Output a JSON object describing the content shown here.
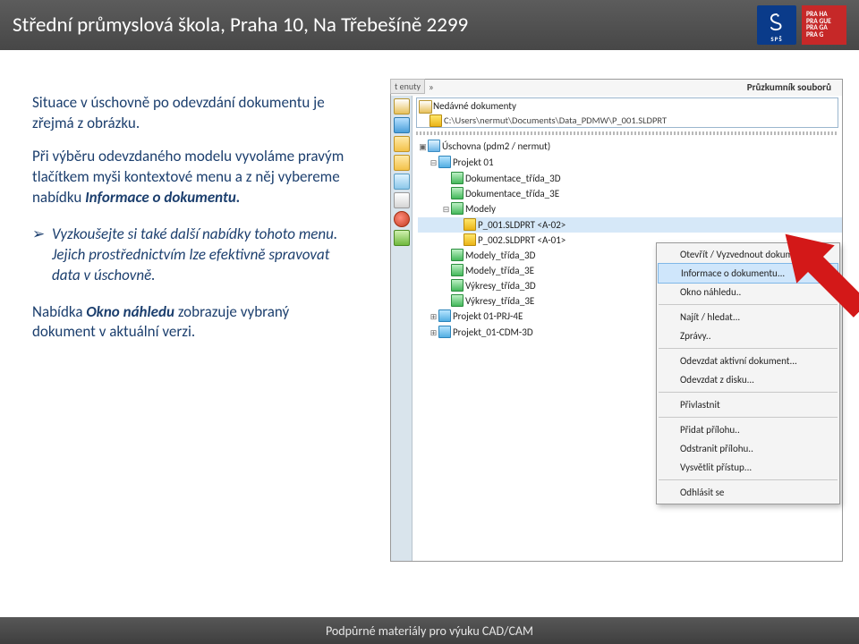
{
  "header": {
    "title": "Střední průmyslová škola, Praha 10, Na Třebešíně 2299",
    "logo_sps_label": "SPŠ",
    "logo_praha_lines": [
      "PRA HA",
      "PRA GUE",
      "PRA GA",
      "PRA G"
    ]
  },
  "body_text": {
    "p1": "Situace v úschovně po odevzdání dokumentu je zřejmá z obrázku.",
    "p2a": "Při výběru odevzdaného modelu vyvoláme pravým tlačítkem myši kontextové menu a z něj vybereme nabídku ",
    "p2b": "Informace o dokumentu.",
    "bullet1": "Vyzkoušejte si také další nabídky tohoto menu.",
    "bullet2": "Jejich prostřednictvím lze efektivně spravovat data v úschovně.",
    "p3a": "Nabídka ",
    "p3b": "Okno náhledu",
    "p3c": " zobrazuje vybraný dokument v aktuální verzi."
  },
  "panel": {
    "tab": "t enuty",
    "chev": "»",
    "title": "Průzkumník souborů",
    "recent_head": "Nedávné dokumenty",
    "recent_row": "C:\\Users\\nermut\\Documents\\Data_PDMW\\P_001.SLDPRT"
  },
  "tree": {
    "root": "Úschovna (pdm2 / nermut)",
    "n1": "Projekt 01",
    "n1_1": "Dokumentace_třída_3D",
    "n1_2": "Dokumentace_třída_3E",
    "n1_3": "Modely",
    "n1_3_1": "P_001.SLDPRT <A-02>",
    "n1_3_2": "P_002.SLDPRT <A-01>",
    "n1_4": "Modely_třída_3D",
    "n1_5": "Modely_třída_3E",
    "n1_6": "Výkresy_třída_3D",
    "n1_7": "Výkresy_třída_3E",
    "n2": "Projekt 01-PRJ-4E",
    "n3": "Projekt_01-CDM-3D"
  },
  "ctx": {
    "i1": "Otevřít / Vyzvednout dokument..",
    "i2": "Informace o dokumentu...",
    "i3": "Okno náhledu..",
    "i4": "Najít / hledat...",
    "i5": "Zprávy..",
    "i6": "Odevzdat aktivní dokument...",
    "i7": "Odevzdat z disku...",
    "i8": "Přivlastnit",
    "i9": "Přidat přílohu..",
    "i10": "Odstranit přílohu..",
    "i11": "Vysvětlit přístup...",
    "i12": "Odhlásit se"
  },
  "footer": {
    "text": "Podpůrné materiály pro výuku CAD/CAM"
  }
}
